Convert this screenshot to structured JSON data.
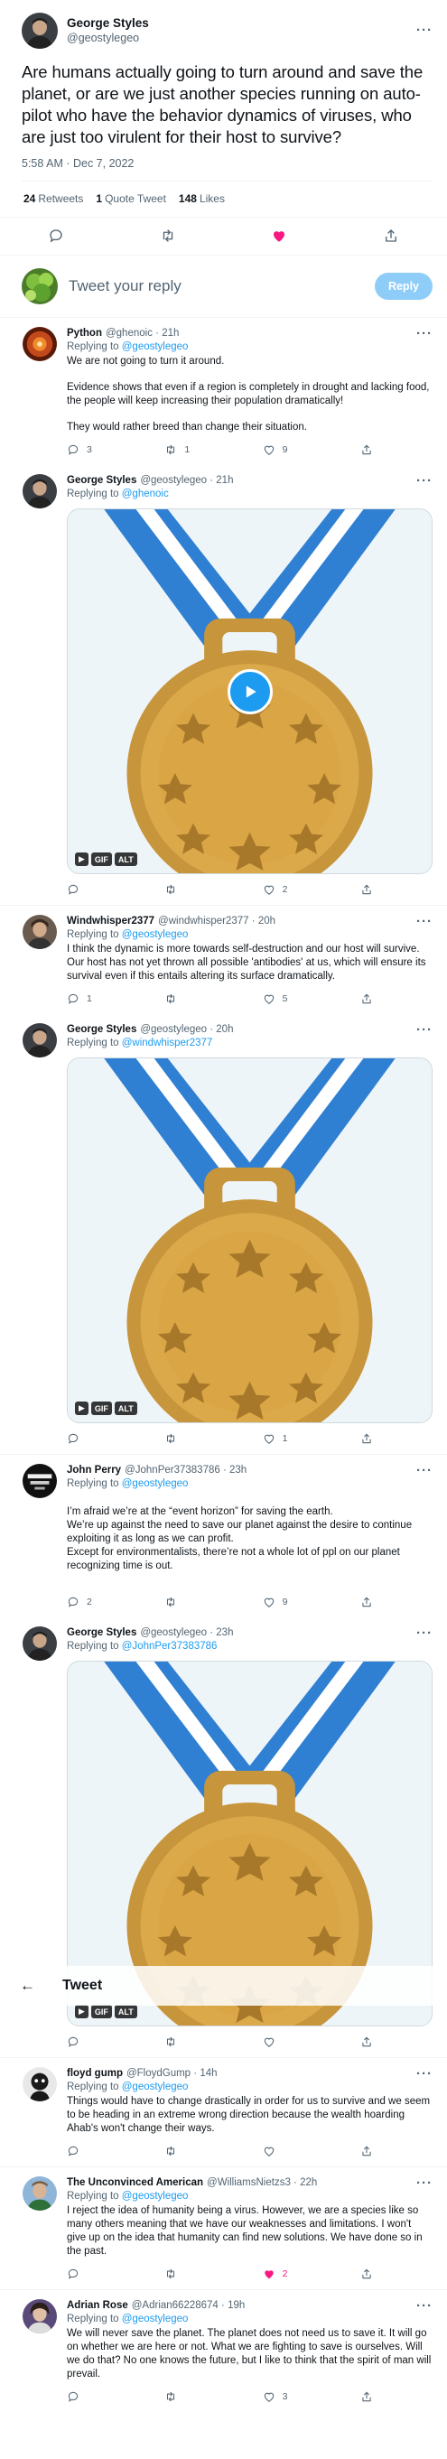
{
  "main_tweet": {
    "name": "George Styles",
    "handle": "@geostylegeo",
    "text": "Are humans actually going to turn around and save the planet, or are we just another species running on auto-pilot who have the behavior dynamics of viruses, who are just too virulent for their host to survive?",
    "timestamp": "5:58 AM · Dec 7, 2022",
    "retweets_count": "24",
    "retweets_label": "Retweets",
    "quotes_count": "1",
    "quotes_label": "Quote Tweet",
    "likes_count": "148",
    "likes_label": "Likes",
    "liked": true
  },
  "reply_box": {
    "placeholder": "Tweet your reply",
    "button_label": "Reply"
  },
  "header": {
    "title": "Tweet"
  },
  "replies": [
    {
      "name": "Python",
      "handle": "@ghenoic",
      "time": "21h",
      "replying_label": "Replying to",
      "replying_to": "@geostylegeo",
      "paragraphs": [
        "We are not going to turn it around.",
        "Evidence shows that even if a region is completely in drought and lacking food, the people will keep increasing their population dramatically!",
        "They would rather breed than change their situation."
      ],
      "replies": "3",
      "retweets": "1",
      "likes": "9"
    },
    {
      "name": "George Styles",
      "handle": "@geostylegeo",
      "time": "21h",
      "replying_label": "Replying to",
      "replying_to": "@ghenoic",
      "media_badges": [
        "GIF",
        "ALT"
      ],
      "replies": "",
      "retweets": "",
      "likes": "2"
    },
    {
      "name": "Windwhisper2377",
      "handle": "@windwhisper2377",
      "time": "20h",
      "replying_label": "Replying to",
      "replying_to": "@geostylegeo",
      "paragraphs": [
        "I think the dynamic is more towards self-destruction and our host will survive. Our host has not yet thrown all possible 'antibodies' at us, which will ensure its survival even if this entails altering its surface dramatically."
      ],
      "replies": "1",
      "retweets": "",
      "likes": "5"
    },
    {
      "name": "George Styles",
      "handle": "@geostylegeo",
      "time": "20h",
      "replying_label": "Replying to",
      "replying_to": "@windwhisper2377",
      "media_badges": [
        "GIF",
        "ALT"
      ],
      "replies": "",
      "retweets": "",
      "likes": "1"
    },
    {
      "name": "John Perry",
      "handle": "@JohnPer37383786",
      "time": "23h",
      "replying_label": "Replying to",
      "replying_to": "@geostylegeo",
      "paragraphs": [
        "I’m afraid we’re at the “event horizon” for saving the earth.\nWe’re up against the need to save our planet against the desire to continue exploiting it as long as we can profit.\nExcept for environmentalists, there’re not a whole lot of ppl on our planet recognizing time is out."
      ],
      "replies": "2",
      "retweets": "",
      "likes": "9"
    },
    {
      "name": "George Styles",
      "handle": "@geostylegeo",
      "time": "23h",
      "replying_label": "Replying to",
      "replying_to": "@JohnPer37383786",
      "media_badges": [
        "GIF",
        "ALT"
      ],
      "replies": "",
      "retweets": "",
      "likes": ""
    },
    {
      "name": "floyd gump",
      "handle": "@FloydGump",
      "time": "14h",
      "replying_label": "Replying to",
      "replying_to": "@geostylegeo",
      "paragraphs": [
        "Things would have to change drastically in order for us to survive and we seem to be heading in an extreme wrong direction because the wealth hoarding Ahab's won't change their ways."
      ],
      "replies": "",
      "retweets": "",
      "likes": ""
    },
    {
      "name": "The Unconvinced American",
      "handle": "@WilliamsNietzs3",
      "time": "22h",
      "replying_label": "Replying to",
      "replying_to": "@geostylegeo",
      "paragraphs": [
        "I reject the idea of humanity being a virus. However, we are a species like so many others meaning that we have our weaknesses and limitations. I won't give up on the idea that humanity can find new solutions. We have done so in the past."
      ],
      "replies": "",
      "retweets": "",
      "likes": "2",
      "liked": true
    },
    {
      "name": "Adrian Rose",
      "handle": "@Adrian66228674",
      "time": "19h",
      "replying_label": "Replying to",
      "replying_to": "@geostylegeo",
      "paragraphs": [
        "We will never save the planet. The planet does not need us to save it. It will go on whether we are here or not. What we are fighting to save is ourselves. Will we do that? No one knows the future, but I like to think that the spirit of man will prevail."
      ],
      "replies": "",
      "retweets": "",
      "likes": "3"
    }
  ]
}
